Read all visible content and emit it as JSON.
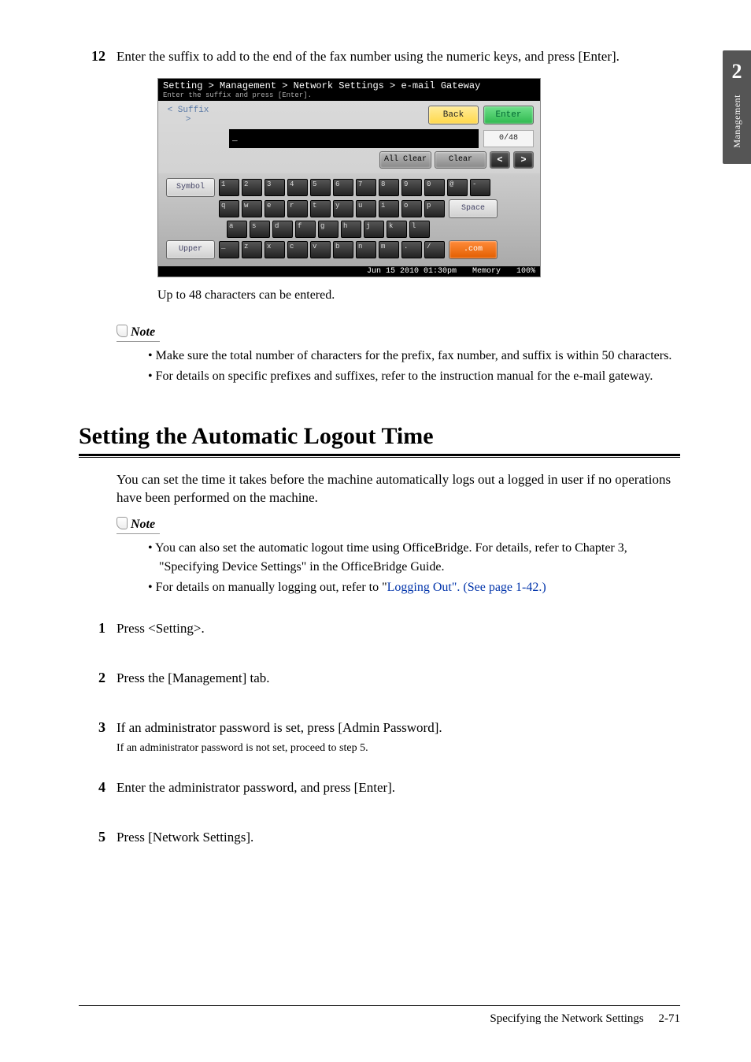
{
  "side_tab": {
    "number": "2",
    "label": "Management"
  },
  "step12": {
    "num": "12",
    "text": "Enter the suffix to add to the end of the fax number using the numeric keys, and press [Enter]."
  },
  "screenshot": {
    "breadcrumb": "Setting > Management > Network Settings > e-mail Gateway",
    "hint": "Enter the suffix and press [Enter].",
    "suffix_label": "< Suffix >",
    "back": "Back",
    "enter": "Enter",
    "input_value": "_",
    "count": "0/48",
    "all_clear": "All Clear",
    "clear": "Clear",
    "arrow_l": "<",
    "arrow_r": ">",
    "symbol": "Symbol",
    "row1": [
      "1",
      "2",
      "3",
      "4",
      "5",
      "6",
      "7",
      "8",
      "9",
      "0",
      "@",
      "-"
    ],
    "row2": [
      "q",
      "w",
      "e",
      "r",
      "t",
      "y",
      "u",
      "i",
      "o",
      "p"
    ],
    "space": "Space",
    "row3": [
      "a",
      "s",
      "d",
      "f",
      "g",
      "h",
      "j",
      "k",
      "l"
    ],
    "upper": "Upper",
    "row4": [
      "_",
      "z",
      "x",
      "c",
      "v",
      "b",
      "n",
      "m",
      ".",
      "/"
    ],
    "com": ".com",
    "status_time": "Jun 15 2010 01:30pm",
    "status_mem_label": "Memory",
    "status_mem_val": "100%"
  },
  "caption_after_shot": "Up to 48 characters can be entered.",
  "note_label": "Note",
  "note1": [
    "Make sure the total number of characters for the prefix, fax number, and suffix is within 50 characters.",
    "For details on specific prefixes and suffixes, refer to the instruction manual for the e-mail gateway."
  ],
  "heading": "Setting the Automatic Logout Time",
  "intro": "You can set the time it takes before the machine automatically logs out a logged in user if no operations have been performed on the machine.",
  "note2_pre": [
    "You can also set the automatic logout time using OfficeBridge. For details, refer to Chapter 3, \"Specifying Device Settings\" in the OfficeBridge Guide."
  ],
  "note2_link_pre": "For details on manually logging out, refer to \"",
  "note2_link_text": "Logging Out\". (See page 1-42.)",
  "steps": [
    {
      "num": "1",
      "text": "Press <Setting>."
    },
    {
      "num": "2",
      "text": "Press the [Management] tab."
    },
    {
      "num": "3",
      "text": "If an administrator password is set, press [Admin Password].",
      "sub": "If an administrator password is not set, proceed to step 5."
    },
    {
      "num": "4",
      "text": "Enter the administrator password, and press [Enter]."
    },
    {
      "num": "5",
      "text": "Press [Network Settings]."
    }
  ],
  "footer": {
    "title": "Specifying the Network Settings",
    "page": "2-71"
  }
}
